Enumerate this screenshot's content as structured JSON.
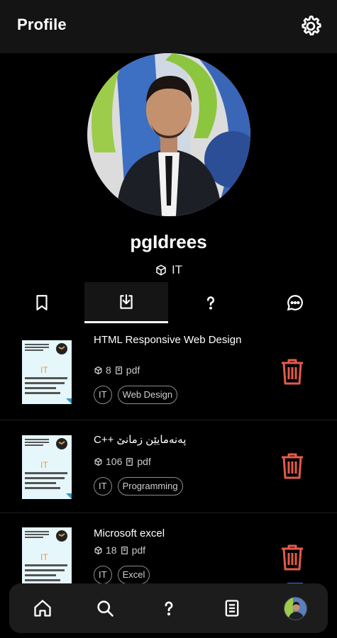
{
  "app_bar": {
    "title": "Profile",
    "settings_icon": "gear-icon"
  },
  "profile": {
    "username": "pgIdrees",
    "department": "IT",
    "department_icon": "box-icon"
  },
  "tabs": [
    {
      "icon": "bookmark-icon",
      "active": false
    },
    {
      "icon": "download-icon",
      "active": true
    },
    {
      "icon": "question-icon",
      "active": false
    },
    {
      "icon": "chat-bubble-icon",
      "active": false
    }
  ],
  "downloads": [
    {
      "title": "HTML Responsive Web Design",
      "count": "8",
      "format": "pdf",
      "tags": [
        "IT",
        "Web Design"
      ],
      "thumb_label": "IT"
    },
    {
      "title": "C++ پەنەمایێن زمانێ",
      "count": "106",
      "format": "pdf",
      "tags": [
        "IT",
        "Programming"
      ],
      "thumb_label": "IT"
    },
    {
      "title": "Microsoft excel",
      "count": "18",
      "format": "pdf",
      "tags": [
        "IT",
        "Excel"
      ],
      "thumb_label": "IT"
    }
  ],
  "bottom_nav": [
    {
      "icon": "home-icon"
    },
    {
      "icon": "search-icon"
    },
    {
      "icon": "question-icon"
    },
    {
      "icon": "document-icon"
    },
    {
      "icon": "profile-avatar"
    }
  ],
  "colors": {
    "background": "#000000",
    "app_bar": "#141414",
    "trash_red": "#e25b4a",
    "thumb_bg": "#e6f7fb",
    "thumb_accent": "#e09a45",
    "nav_bg": "#1c1c1c"
  }
}
